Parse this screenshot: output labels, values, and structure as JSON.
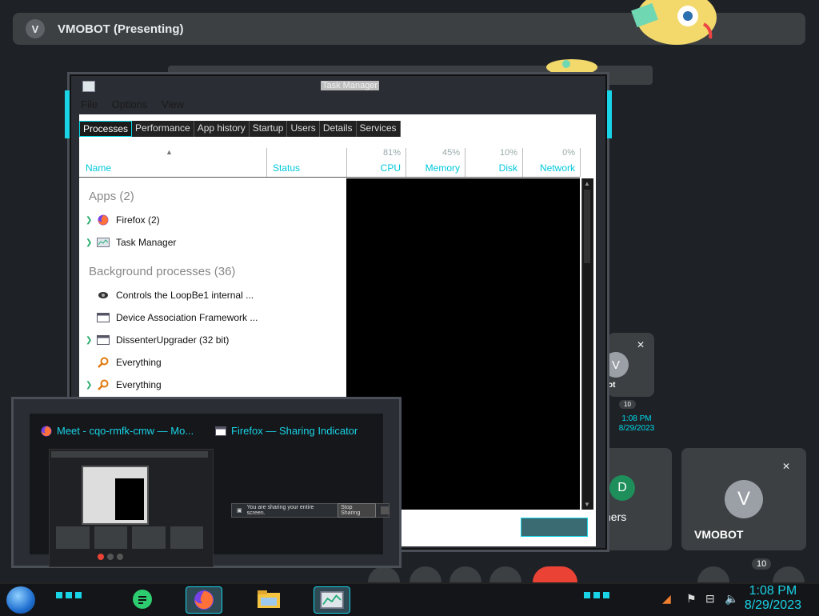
{
  "meet": {
    "presenter_initial": "V",
    "presenter_title": "VMOBOT (Presenting)",
    "tiles": [
      {
        "initial": "V",
        "name": "VMOBOT"
      },
      {
        "initial": "D",
        "name": "hers"
      },
      {
        "initial": "V",
        "name": "ot"
      }
    ],
    "badge_count": "10",
    "small_badge_count": "10",
    "small_clock_time": "1:08 PM",
    "small_clock_date": "8/29/2023"
  },
  "task_manager": {
    "title": "Task Manager",
    "menu": [
      "File",
      "Options",
      "View"
    ],
    "tabs": [
      "Processes",
      "Performance",
      "App history",
      "Startup",
      "Users",
      "Details",
      "Services"
    ],
    "active_tab": "Processes",
    "columns": {
      "name": "Name",
      "status": "Status",
      "cpu": {
        "label": "CPU",
        "pct": "81%"
      },
      "memory": {
        "label": "Memory",
        "pct": "45%"
      },
      "disk": {
        "label": "Disk",
        "pct": "10%"
      },
      "network": {
        "label": "Network",
        "pct": "0%"
      }
    },
    "groups": {
      "apps": "Apps (2)",
      "background": "Background processes (36)"
    },
    "apps": [
      {
        "name": "Firefox (2)",
        "icon": "firefox-icon"
      },
      {
        "name": "Task Manager",
        "icon": "task-manager-icon"
      }
    ],
    "background": [
      {
        "name": "Controls the LoopBe1 internal ...",
        "icon": "audio-icon"
      },
      {
        "name": "Device Association Framework ...",
        "icon": "window-icon"
      },
      {
        "name": "DissenterUpgrader (32 bit)",
        "icon": "window-icon"
      },
      {
        "name": "Everything",
        "icon": "magnifier-icon"
      },
      {
        "name": "Everything",
        "icon": "magnifier-icon"
      }
    ]
  },
  "thumbnails": {
    "left_title": "Meet - cqo-rmfk-cmw — Mo...",
    "right_title": "Firefox — Sharing Indicator",
    "share_text": "You are sharing your entire screen.",
    "stop_label": "Stop Sharing"
  },
  "taskbar": {
    "clock_time": "1:08 PM",
    "clock_date": "8/29/2023",
    "apps": [
      "chat-app",
      "firefox",
      "file-explorer",
      "task-manager"
    ]
  },
  "colors": {
    "accent": "#19d3e6",
    "meet_tile": "#3c4043",
    "taskbar": "#141518"
  }
}
